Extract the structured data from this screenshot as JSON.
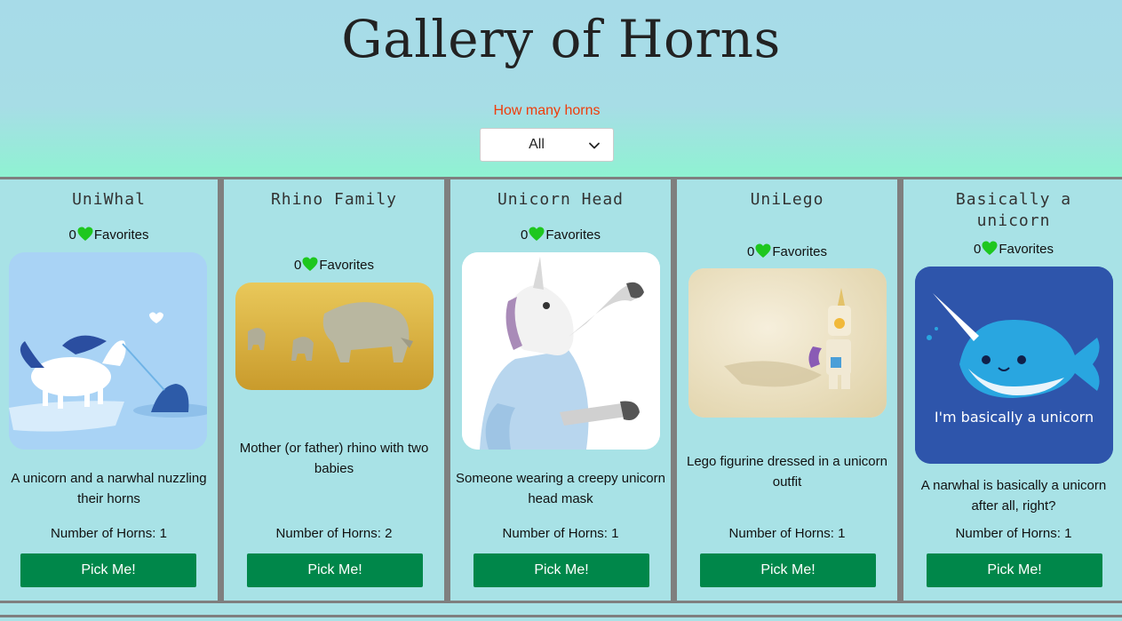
{
  "header": {
    "title": "Gallery of Horns",
    "filter_label": "How many horns",
    "filter_value": "All"
  },
  "cards": [
    {
      "title": "UniWhal",
      "favorites": "0",
      "favorites_label": "Favorites",
      "description": "A unicorn and a narwhal nuzzling their horns",
      "horns_text": "Number of Horns: 1",
      "button_label": "Pick Me!"
    },
    {
      "title": "Rhino Family",
      "favorites": "0",
      "favorites_label": "Favorites",
      "description": "Mother (or father) rhino with two babies",
      "horns_text": "Number of Horns: 2",
      "button_label": "Pick Me!"
    },
    {
      "title": "Unicorn Head",
      "favorites": "0",
      "favorites_label": "Favorites",
      "description": "Someone wearing a creepy unicorn head mask",
      "horns_text": "Number of Horns: 1",
      "button_label": "Pick Me!"
    },
    {
      "title": "UniLego",
      "favorites": "0",
      "favorites_label": "Favorites",
      "description": "Lego figurine dressed in a unicorn outfit",
      "horns_text": "Number of Horns: 1",
      "button_label": "Pick Me!"
    },
    {
      "title": "Basically a unicorn",
      "favorites": "0",
      "favorites_label": "Favorites",
      "description": "A narwhal is basically a unicorn after all, right?",
      "horns_text": "Number of Horns: 1",
      "button_label": "Pick Me!",
      "image_caption": "I'm basically a unicorn"
    }
  ],
  "icons": {
    "heart": "green-heart-icon",
    "chevron": "chevron-down-icon"
  },
  "colors": {
    "header_bg": "#a7dbe8",
    "filter_label": "#ef3d0a",
    "button_bg": "#00874a",
    "heart": "#1ec71e",
    "card_bg": "#a8e2e6",
    "grid_border": "#7f7f7f"
  }
}
